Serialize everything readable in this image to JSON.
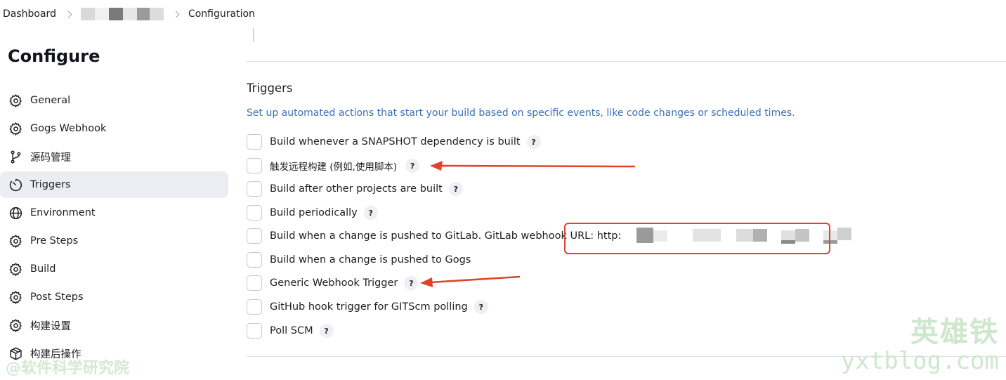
{
  "breadcrumb": {
    "dashboard": "Dashboard",
    "current": "Configuration"
  },
  "sidebar": {
    "title": "Configure",
    "items": [
      {
        "label": "General",
        "icon": "gear-icon"
      },
      {
        "label": "Gogs Webhook",
        "icon": "gear-icon"
      },
      {
        "label": "源码管理",
        "icon": "branch-icon"
      },
      {
        "label": "Triggers",
        "icon": "timer-icon",
        "active": true
      },
      {
        "label": "Environment",
        "icon": "globe-icon"
      },
      {
        "label": "Pre Steps",
        "icon": "gear-icon"
      },
      {
        "label": "Build",
        "icon": "gear-icon"
      },
      {
        "label": "Post Steps",
        "icon": "gear-icon"
      },
      {
        "label": "构建设置",
        "icon": "gear-icon"
      },
      {
        "label": "构建后操作",
        "icon": "package-icon"
      }
    ]
  },
  "triggers": {
    "title": "Triggers",
    "description": "Set up automated actions that start your build based on specific events, like code changes or scheduled times.",
    "options": [
      {
        "label": "Build whenever a SNAPSHOT dependency is built",
        "help": "?",
        "checked": false
      },
      {
        "label": "触发远程构建 (例如,使用脚本)",
        "help": "?",
        "checked": false
      },
      {
        "label": "Build after other projects are built",
        "help": "?",
        "checked": false
      },
      {
        "label": "Build periodically",
        "help": "?",
        "checked": false
      },
      {
        "label": "Build when a change is pushed to GitLab. GitLab webhook URL: http:",
        "help": "",
        "checked": false
      },
      {
        "label": "Build when a change is pushed to Gogs",
        "help": "",
        "checked": false
      },
      {
        "label": "Generic Webhook Trigger",
        "help": "?",
        "checked": false
      },
      {
        "label": "GitHub hook trigger for GITScm polling",
        "help": "?",
        "checked": false
      },
      {
        "label": "Poll SCM",
        "help": "?",
        "checked": false
      }
    ]
  },
  "watermarks": {
    "left": "@软件科学研究院",
    "right_cn": "英雄铁",
    "right_url": "yxtblog.com"
  },
  "colors": {
    "link_blue": "#3b6fb6",
    "active_nav_bg": "#ecedf2",
    "annotation_red": "#e0432a"
  }
}
